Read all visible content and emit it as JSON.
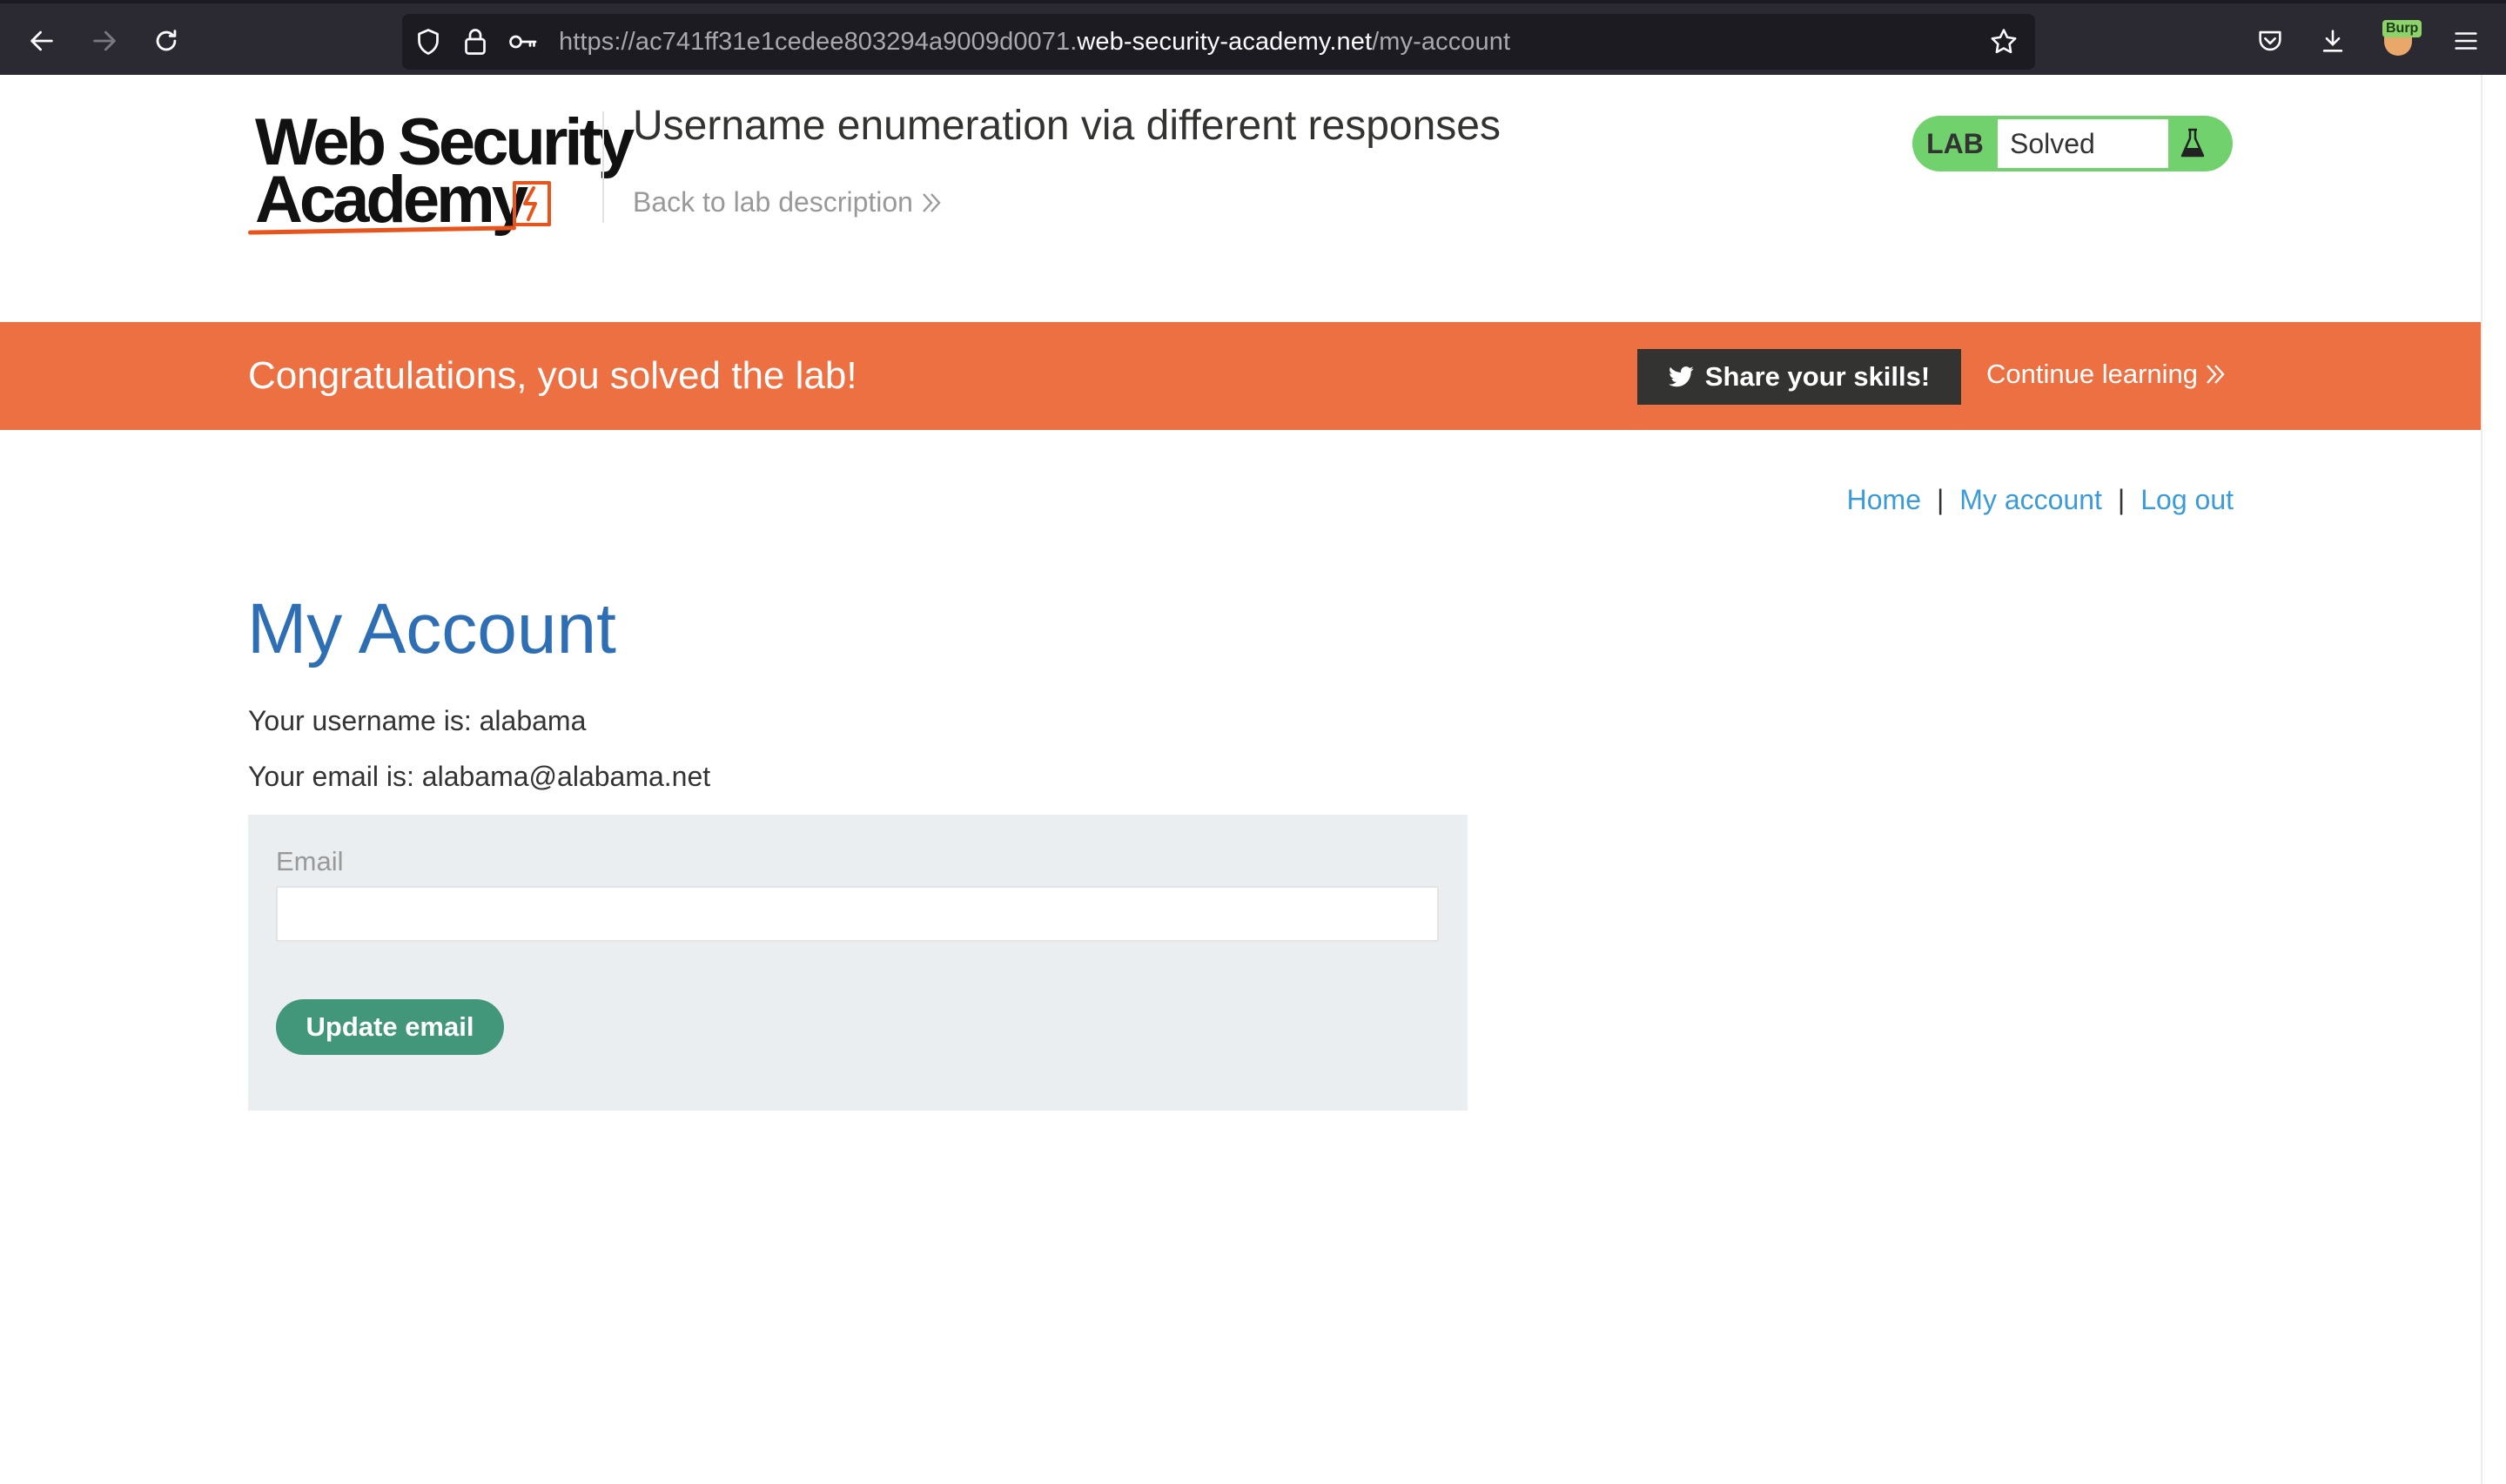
{
  "browser": {
    "url_prefix": "https://ac741ff31e1cedee803294a9009d0071.",
    "url_domain": "web-security-academy.net",
    "url_path": "/my-account",
    "extension_badge": "Burp"
  },
  "header": {
    "logo_line1": "Web Security",
    "logo_line2": "Academy",
    "lab_title": "Username enumeration via different responses",
    "back_link": "Back to lab description",
    "lab_tag": "LAB",
    "lab_status": "Solved"
  },
  "banner": {
    "message": "Congratulations, you solved the lab!",
    "share_label": "Share your skills!",
    "continue_label": "Continue learning"
  },
  "nav": {
    "home": "Home",
    "separator": "|",
    "my_account": "My account",
    "log_out": "Log out"
  },
  "account": {
    "title": "My Account",
    "username_line": "Your username is: alabama",
    "email_line": "Your email is: alabama@alabama.net",
    "email_label": "Email",
    "email_value": "",
    "update_button": "Update email"
  },
  "colors": {
    "browser_chrome": "#2b2a33",
    "banner": "#ed7043",
    "lab_solved": "#70d16d",
    "link": "#3a9bd8",
    "title": "#2e6eb5",
    "update_button": "#42977b",
    "form_panel": "#ebeef1"
  }
}
